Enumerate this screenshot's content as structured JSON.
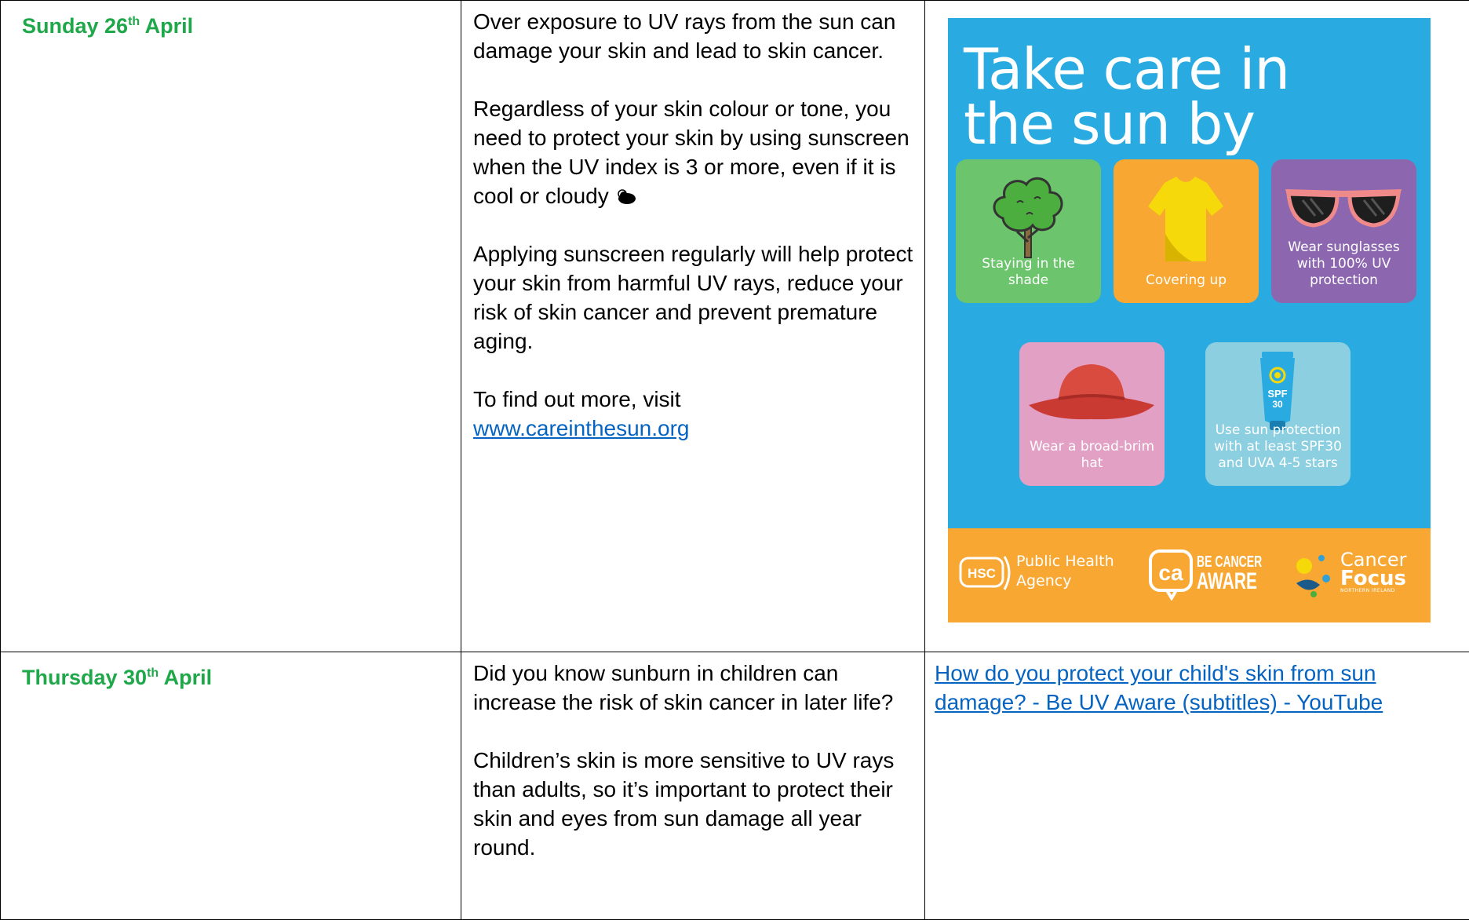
{
  "rows": [
    {
      "date_day": "Sunday 26",
      "date_suffix": "th",
      "date_month": " April",
      "paragraphs": [
        "Over exposure to UV rays from the sun can damage your skin and lead to skin cancer.",
        "Regardless of your skin colour or tone, you need to protect your skin by using sunscreen when the UV index is 3 or more, even if it is cool or cloudy",
        "Applying sunscreen regularly will help protect your skin from harmful UV rays, reduce your risk of skin cancer and prevent premature aging."
      ],
      "visit_text": "To find out more, visit",
      "visit_link": "www.careinthesun.org"
    },
    {
      "date_day": "Thursday 30",
      "date_suffix": "th",
      "date_month": " April",
      "paragraphs": [
        "Did you know sunburn in children can increase the risk of skin cancer in later life?",
        "Children’s skin is more sensitive to UV rays than adults, so it’s important to protect their skin and eyes from sun damage all year round."
      ],
      "video_link": "How do you protect your child's skin from sun damage? - Be UV Aware (subtitles) - YouTube"
    }
  ],
  "poster": {
    "title": "Take care in\nthe sun by",
    "tiles": [
      {
        "caption": "Staying in the shade",
        "icon": "tree-icon"
      },
      {
        "caption": "Covering up",
        "icon": "tshirt-icon"
      },
      {
        "caption": "Wear sunglasses with 100% UV protection",
        "icon": "sunglasses-icon"
      },
      {
        "caption": "Wear a broad-brim hat",
        "icon": "hat-icon"
      },
      {
        "caption": "Use sun protection with at least SPF30 and UVA 4-5 stars",
        "icon": "sunscreen-icon"
      }
    ],
    "sunscreen_label_1": "SPF",
    "sunscreen_label_2": "30",
    "footer": {
      "hsc": "HSC",
      "pha_line1": "Public Health",
      "pha_line2": "Agency",
      "bca_line1": "BE CANCER",
      "bca_line2": "AWARE",
      "bca_mark": "ca",
      "cf_line1": "Cancer",
      "cf_line2": "Focus",
      "cf_line3": "NORTHERN IRELAND"
    },
    "colors": {
      "background": "#29abe2",
      "footer": "#f7a732",
      "shade_tile": "#6cc46c",
      "cover_tile": "#f7a732",
      "glasses_tile": "#8c67b0",
      "hat_tile": "#e3a0c5",
      "spf_tile": "#8bcfe0"
    }
  },
  "colors": {
    "date": "#1fa84a",
    "link": "#0563c1"
  }
}
